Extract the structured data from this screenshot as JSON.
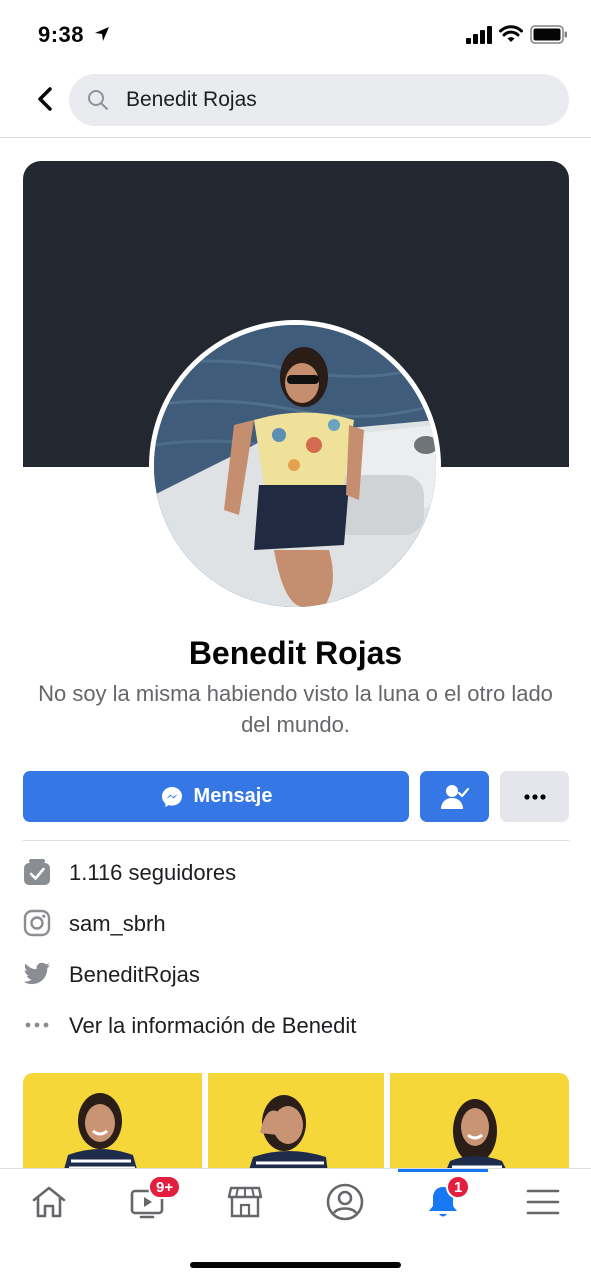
{
  "status_bar": {
    "time": "9:38"
  },
  "search": {
    "query": "Benedit Rojas"
  },
  "profile": {
    "name": "Benedit Rojas",
    "bio": "No soy la misma habiendo visto la luna o el otro lado del mundo."
  },
  "actions": {
    "message_label": "Mensaje"
  },
  "info": {
    "followers": "1.116 seguidores",
    "instagram": "sam_sbrh",
    "twitter": "BeneditRojas",
    "more_info": "Ver la información de Benedit"
  },
  "nav": {
    "watch_badge": "9+",
    "notifications_badge": "1",
    "active_tab": "notifications"
  },
  "colors": {
    "accent": "#3578e5",
    "badge": "#e41e3f",
    "cover": "#23272f"
  }
}
